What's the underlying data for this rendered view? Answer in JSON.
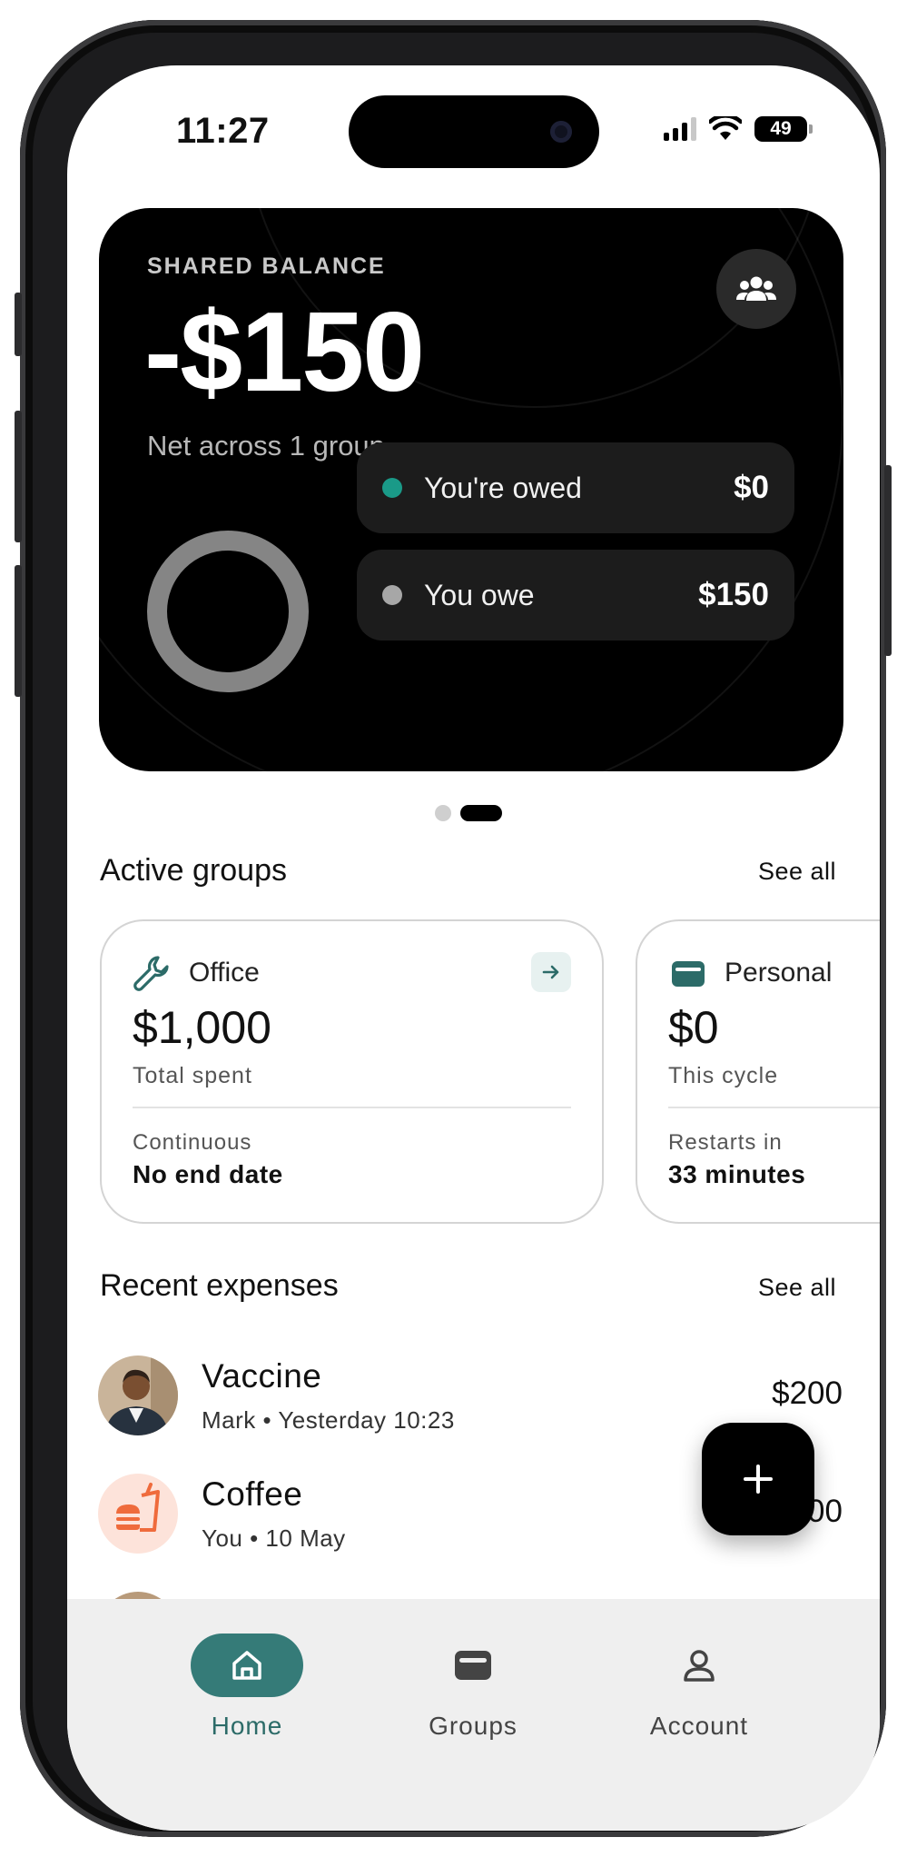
{
  "status_bar": {
    "time": "11:27",
    "battery": "49"
  },
  "balance": {
    "label": "SHARED BALANCE",
    "amount": "-$150",
    "subtitle": "Net across 1 group",
    "owed_label": "You're owed",
    "owed_value": "$0",
    "owe_label": "You owe",
    "owe_value": "$150",
    "owed_color": "#1a9a88",
    "owe_color": "#a7a7a7"
  },
  "active_groups": {
    "title": "Active groups",
    "see_all": "See all",
    "items": [
      {
        "name": "Office",
        "icon": "wrench-icon",
        "amount": "$1,000",
        "amount_label": "Total spent",
        "meta_label": "Continuous",
        "meta_value": "No end date"
      },
      {
        "name": "Personal",
        "icon": "wallet-icon",
        "amount": "$0",
        "amount_label": "This cycle",
        "meta_label": "Restarts in",
        "meta_value": "33 minutes"
      }
    ]
  },
  "recent_expenses": {
    "title": "Recent expenses",
    "see_all": "See all",
    "items": [
      {
        "title": "Vaccine",
        "subtitle": "Mark • Yesterday 10:23",
        "amount": "$200",
        "avatar": "person-photo"
      },
      {
        "title": "Coffee",
        "subtitle": "You • 10 May",
        "amount": "$200",
        "avatar": "food-icon"
      }
    ]
  },
  "tabs": [
    {
      "label": "Home",
      "icon": "home-icon",
      "active": true
    },
    {
      "label": "Groups",
      "icon": "wallet-icon",
      "active": false
    },
    {
      "label": "Account",
      "icon": "user-icon",
      "active": false
    }
  ],
  "colors": {
    "accent": "#357b78",
    "card_bg": "#000000",
    "tabbar_bg": "#efefef"
  }
}
